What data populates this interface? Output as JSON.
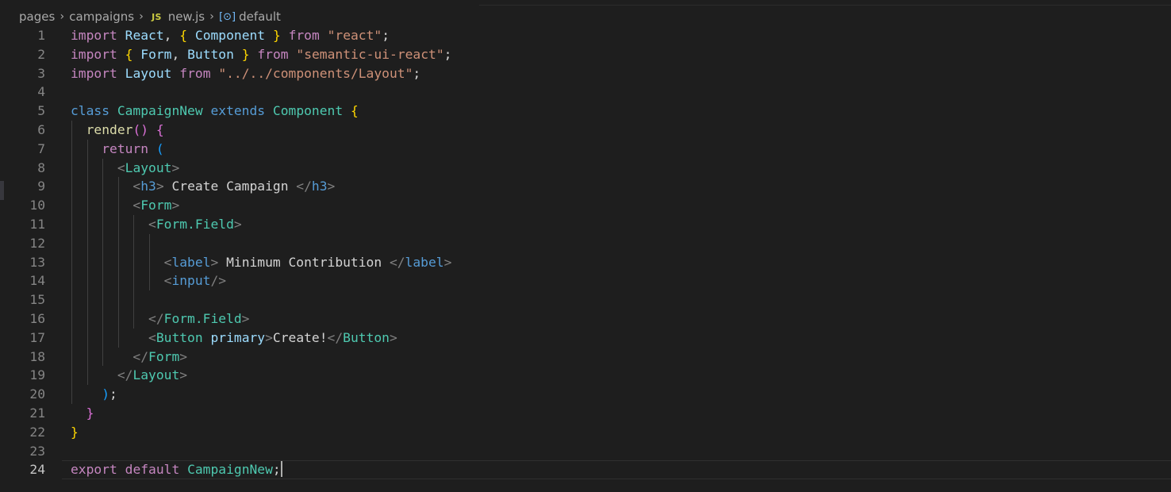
{
  "breadcrumb": {
    "segments": [
      "pages",
      "campaigns"
    ],
    "file": {
      "badge": "JS",
      "name": "new.js"
    },
    "symbol": {
      "icon": "variable-symbol-icon",
      "name": "default"
    }
  },
  "editor": {
    "current_line": 24,
    "colors": {
      "keyword_blue": "#569cd6",
      "control_purple": "#c586c0",
      "variable_light": "#9cdcfe",
      "class_teal": "#4ec9b0",
      "string_orange": "#ce9178",
      "function_yellow": "#dcdcaa",
      "bracket_gold": "#ffd700",
      "bracket_pink": "#da70d6",
      "bracket_blue": "#179fff"
    },
    "lines": [
      {
        "n": "1",
        "tokens": [
          [
            "import",
            "#c586c0"
          ],
          [
            " ",
            "#d4d4d4"
          ],
          [
            "React",
            "#9cdcfe"
          ],
          [
            ", ",
            "#d4d4d4"
          ],
          [
            "{",
            "#ffd700"
          ],
          [
            " ",
            "#d4d4d4"
          ],
          [
            "Component",
            "#9cdcfe"
          ],
          [
            " ",
            "#d4d4d4"
          ],
          [
            "}",
            "#ffd700"
          ],
          [
            " ",
            "#d4d4d4"
          ],
          [
            "from",
            "#c586c0"
          ],
          [
            " ",
            "#d4d4d4"
          ],
          [
            "\"react\"",
            "#ce9178"
          ],
          [
            ";",
            "#d4d4d4"
          ]
        ]
      },
      {
        "n": "2",
        "tokens": [
          [
            "import",
            "#c586c0"
          ],
          [
            " ",
            "#d4d4d4"
          ],
          [
            "{",
            "#ffd700"
          ],
          [
            " ",
            "#d4d4d4"
          ],
          [
            "Form",
            "#9cdcfe"
          ],
          [
            ", ",
            "#d4d4d4"
          ],
          [
            "Button",
            "#9cdcfe"
          ],
          [
            " ",
            "#d4d4d4"
          ],
          [
            "}",
            "#ffd700"
          ],
          [
            " ",
            "#d4d4d4"
          ],
          [
            "from",
            "#c586c0"
          ],
          [
            " ",
            "#d4d4d4"
          ],
          [
            "\"semantic-ui-react\"",
            "#ce9178"
          ],
          [
            ";",
            "#d4d4d4"
          ]
        ]
      },
      {
        "n": "3",
        "tokens": [
          [
            "import",
            "#c586c0"
          ],
          [
            " ",
            "#d4d4d4"
          ],
          [
            "Layout",
            "#9cdcfe"
          ],
          [
            " ",
            "#d4d4d4"
          ],
          [
            "from",
            "#c586c0"
          ],
          [
            " ",
            "#d4d4d4"
          ],
          [
            "\"../../components/Layout\"",
            "#ce9178"
          ],
          [
            ";",
            "#d4d4d4"
          ]
        ]
      },
      {
        "n": "4",
        "tokens": []
      },
      {
        "n": "5",
        "tokens": [
          [
            "class",
            "#569cd6"
          ],
          [
            " ",
            "#d4d4d4"
          ],
          [
            "CampaignNew",
            "#4ec9b0"
          ],
          [
            " ",
            "#d4d4d4"
          ],
          [
            "extends",
            "#569cd6"
          ],
          [
            " ",
            "#d4d4d4"
          ],
          [
            "Component",
            "#4ec9b0"
          ],
          [
            " ",
            "#d4d4d4"
          ],
          [
            "{",
            "#ffd700"
          ]
        ]
      },
      {
        "n": "6",
        "tokens": [
          [
            "  ",
            "#d4d4d4"
          ],
          [
            "render",
            "#dcdcaa"
          ],
          [
            "()",
            "#da70d6"
          ],
          [
            " ",
            "#d4d4d4"
          ],
          [
            "{",
            "#da70d6"
          ]
        ]
      },
      {
        "n": "7",
        "tokens": [
          [
            "    ",
            "#d4d4d4"
          ],
          [
            "return",
            "#c586c0"
          ],
          [
            " ",
            "#d4d4d4"
          ],
          [
            "(",
            "#179fff"
          ]
        ]
      },
      {
        "n": "8",
        "tokens": [
          [
            "      ",
            "#d4d4d4"
          ],
          [
            "<",
            "#808080"
          ],
          [
            "Layout",
            "#4ec9b0"
          ],
          [
            ">",
            "#808080"
          ]
        ]
      },
      {
        "n": "9",
        "tokens": [
          [
            "        ",
            "#d4d4d4"
          ],
          [
            "<",
            "#808080"
          ],
          [
            "h3",
            "#569cd6"
          ],
          [
            ">",
            "#808080"
          ],
          [
            " Create Campaign ",
            "#d4d4d4"
          ],
          [
            "</",
            "#808080"
          ],
          [
            "h3",
            "#569cd6"
          ],
          [
            ">",
            "#808080"
          ]
        ]
      },
      {
        "n": "10",
        "tokens": [
          [
            "        ",
            "#d4d4d4"
          ],
          [
            "<",
            "#808080"
          ],
          [
            "Form",
            "#4ec9b0"
          ],
          [
            ">",
            "#808080"
          ]
        ]
      },
      {
        "n": "11",
        "tokens": [
          [
            "          ",
            "#d4d4d4"
          ],
          [
            "<",
            "#808080"
          ],
          [
            "Form.Field",
            "#4ec9b0"
          ],
          [
            ">",
            "#808080"
          ]
        ]
      },
      {
        "n": "12",
        "tokens": []
      },
      {
        "n": "13",
        "tokens": [
          [
            "            ",
            "#d4d4d4"
          ],
          [
            "<",
            "#808080"
          ],
          [
            "label",
            "#569cd6"
          ],
          [
            ">",
            "#808080"
          ],
          [
            " Minimum Contribution ",
            "#d4d4d4"
          ],
          [
            "</",
            "#808080"
          ],
          [
            "label",
            "#569cd6"
          ],
          [
            ">",
            "#808080"
          ]
        ]
      },
      {
        "n": "14",
        "tokens": [
          [
            "            ",
            "#d4d4d4"
          ],
          [
            "<",
            "#808080"
          ],
          [
            "input",
            "#569cd6"
          ],
          [
            "/>",
            "#808080"
          ]
        ]
      },
      {
        "n": "15",
        "tokens": []
      },
      {
        "n": "16",
        "tokens": [
          [
            "          ",
            "#d4d4d4"
          ],
          [
            "</",
            "#808080"
          ],
          [
            "Form.Field",
            "#4ec9b0"
          ],
          [
            ">",
            "#808080"
          ]
        ]
      },
      {
        "n": "17",
        "tokens": [
          [
            "          ",
            "#d4d4d4"
          ],
          [
            "<",
            "#808080"
          ],
          [
            "Button",
            "#4ec9b0"
          ],
          [
            " ",
            "#d4d4d4"
          ],
          [
            "primary",
            "#9cdcfe"
          ],
          [
            ">",
            "#808080"
          ],
          [
            "Create!",
            "#d4d4d4"
          ],
          [
            "</",
            "#808080"
          ],
          [
            "Button",
            "#4ec9b0"
          ],
          [
            ">",
            "#808080"
          ]
        ]
      },
      {
        "n": "18",
        "tokens": [
          [
            "        ",
            "#d4d4d4"
          ],
          [
            "</",
            "#808080"
          ],
          [
            "Form",
            "#4ec9b0"
          ],
          [
            ">",
            "#808080"
          ]
        ]
      },
      {
        "n": "19",
        "tokens": [
          [
            "      ",
            "#d4d4d4"
          ],
          [
            "</",
            "#808080"
          ],
          [
            "Layout",
            "#4ec9b0"
          ],
          [
            ">",
            "#808080"
          ]
        ]
      },
      {
        "n": "20",
        "tokens": [
          [
            "    ",
            "#d4d4d4"
          ],
          [
            ")",
            "#179fff"
          ],
          [
            ";",
            "#d4d4d4"
          ]
        ]
      },
      {
        "n": "21",
        "tokens": [
          [
            "  ",
            "#d4d4d4"
          ],
          [
            "}",
            "#da70d6"
          ]
        ]
      },
      {
        "n": "22",
        "tokens": [
          [
            "}",
            "#ffd700"
          ]
        ]
      },
      {
        "n": "23",
        "tokens": []
      },
      {
        "n": "24",
        "tokens": [
          [
            "export",
            "#c586c0"
          ],
          [
            " ",
            "#d4d4d4"
          ],
          [
            "default",
            "#c586c0"
          ],
          [
            " ",
            "#d4d4d4"
          ],
          [
            "CampaignNew",
            "#4ec9b0"
          ],
          [
            ";",
            "#d4d4d4"
          ]
        ]
      }
    ]
  }
}
